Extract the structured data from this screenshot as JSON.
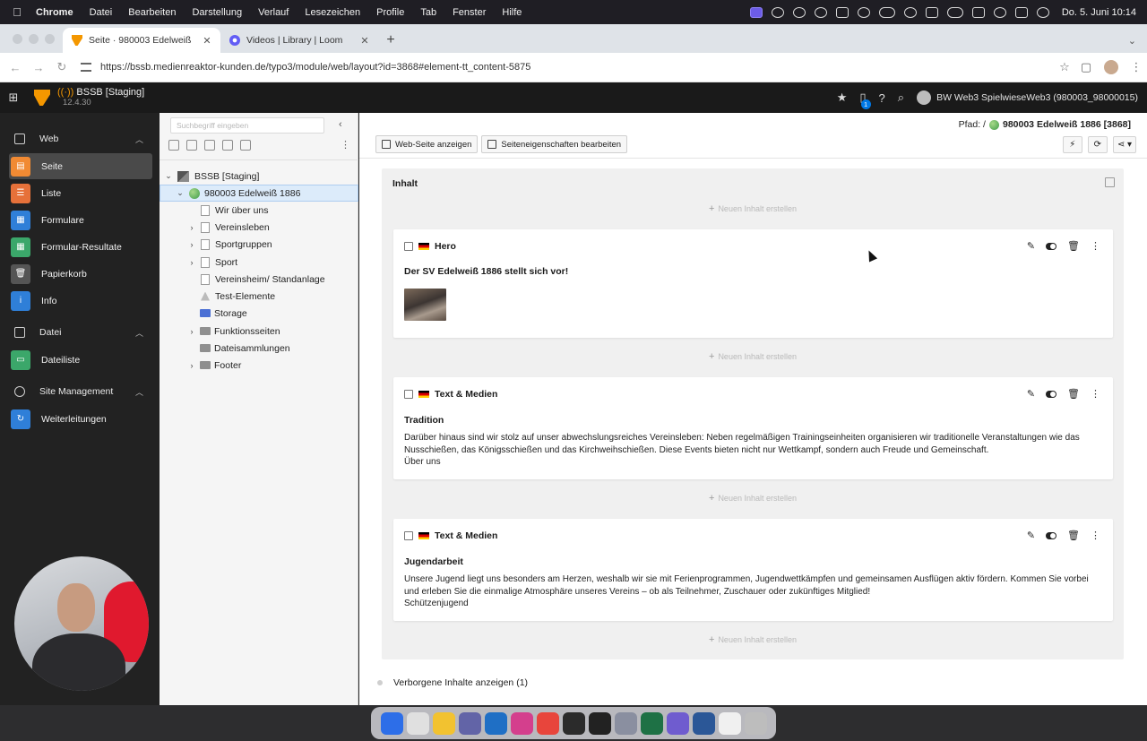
{
  "mac_menubar": {
    "app_name": "Chrome",
    "menus": [
      "Datei",
      "Bearbeiten",
      "Darstellung",
      "Verlauf",
      "Lesezeichen",
      "Profile",
      "Tab",
      "Fenster",
      "Hilfe"
    ],
    "clock": "Do. 5. Juni  10:14"
  },
  "browser": {
    "tabs": [
      {
        "title": "Seite · 980003 Edelweiß 1886",
        "active": true,
        "icon": "typo3-icon"
      },
      {
        "title": "Videos | Library | Loom",
        "active": false,
        "icon": "loom-icon"
      }
    ],
    "url": "https://bssb.medienreaktor-kunden.de/typo3/module/web/layout?id=3868#element-tt_content-5875"
  },
  "typo3_topbar": {
    "site_name": "BSSB [Staging]",
    "version": "12.4.30",
    "notification_count": "1",
    "user": "BW Web3 SpielwieseWeb3 (980003_98000015)"
  },
  "module_menu": {
    "groups": [
      {
        "label": "Web",
        "items": [
          {
            "label": "Seite",
            "color": "#f18a33",
            "active": true
          },
          {
            "label": "Liste",
            "color": "#e6713a",
            "active": false
          },
          {
            "label": "Formulare",
            "color": "#2f7fd8",
            "active": false
          },
          {
            "label": "Formular-Resultate",
            "color": "#3ba76a",
            "active": false
          },
          {
            "label": "Papierkorb",
            "color": "#555555",
            "active": false
          },
          {
            "label": "Info",
            "color": "#2f7fd8",
            "active": false
          }
        ]
      },
      {
        "label": "Datei",
        "items": [
          {
            "label": "Dateiliste",
            "color": "#3ba76a",
            "active": false
          }
        ]
      },
      {
        "label": "Site Management",
        "items": [
          {
            "label": "Weiterleitungen",
            "color": "#2f7fd8",
            "active": false
          }
        ]
      }
    ]
  },
  "page_tree": {
    "search_placeholder": "Suchbegriff eingeben",
    "nodes": [
      {
        "label": "BSSB [Staging]",
        "level": 0,
        "expanded": true,
        "icon": "site",
        "selected": false
      },
      {
        "label": "980003 Edelweiß 1886",
        "level": 1,
        "expanded": true,
        "icon": "globe",
        "selected": true
      },
      {
        "label": "Wir über uns",
        "level": 2,
        "expanded": null,
        "icon": "page",
        "selected": false
      },
      {
        "label": "Vereinsleben",
        "level": 2,
        "expanded": false,
        "icon": "page",
        "selected": false
      },
      {
        "label": "Sportgruppen",
        "level": 2,
        "expanded": false,
        "icon": "page",
        "selected": false
      },
      {
        "label": "Sport",
        "level": 2,
        "expanded": false,
        "icon": "page",
        "selected": false
      },
      {
        "label": "Vereinsheim/ Standanlage",
        "level": 2,
        "expanded": null,
        "icon": "page",
        "selected": false
      },
      {
        "label": "Test-Elemente",
        "level": 2,
        "expanded": null,
        "icon": "shortcut",
        "selected": false
      },
      {
        "label": "Storage",
        "level": 2,
        "expanded": null,
        "icon": "folder-blue",
        "selected": false
      },
      {
        "label": "Funktionsseiten",
        "level": 2,
        "expanded": false,
        "icon": "folder",
        "selected": false
      },
      {
        "label": "Dateisammlungen",
        "level": 2,
        "expanded": null,
        "icon": "folder",
        "selected": false
      },
      {
        "label": "Footer",
        "level": 2,
        "expanded": false,
        "icon": "folder",
        "selected": false
      }
    ]
  },
  "content": {
    "path_label": "Pfad: /",
    "path_page": "980003 Edelweiß 1886 [3868]",
    "buttons": {
      "view": "Web-Seite anzeigen",
      "edit_props": "Seiteneigenschaften bearbeiten"
    },
    "column_title": "Inhalt",
    "new_content_label": "Neuen Inhalt erstellen",
    "elements": [
      {
        "type": "Hero",
        "headline": "Der SV Edelweiß 1886 stellt sich vor!",
        "body": "",
        "link": ""
      },
      {
        "type": "Text & Medien",
        "headline": "Tradition",
        "body": "Darüber hinaus sind wir stolz auf unser abwechslungsreiches Vereinsleben: Neben regelmäßigen Trainingseinheiten organisieren wir traditionelle Veranstaltungen wie das Nusschießen, das Königsschießen und das Kirchweihschießen. Diese Events bieten nicht nur Wettkampf, sondern auch Freude und Gemeinschaft.",
        "link": "Über uns"
      },
      {
        "type": "Text & Medien",
        "headline": "Jugendarbeit",
        "body": "Unsere Jugend liegt uns besonders am Herzen, weshalb wir sie mit Ferienprogrammen, Jugendwettkämpfen und gemeinsamen Ausflügen aktiv fördern. Kommen Sie vorbei und erleben Sie die einmalige Atmosphäre unseres Vereins – ob als Teilnehmer, Zuschauer oder zukünftiges Mitglied!",
        "link": "Schützenjugend"
      }
    ],
    "hidden_toggle": "Verborgene Inhalte anzeigen (1)"
  },
  "dock_colors": [
    "#2d6ee8",
    "#e0e0e0",
    "#f2c230",
    "#6264a7",
    "#1f6fc5",
    "#d43f8d",
    "#e8453c",
    "#2b2b2b",
    "#222222",
    "#8a8fa0",
    "#1e7145",
    "#6f5ccf",
    "#2b5797",
    "#f0f0f0",
    "#bdbdbd"
  ]
}
